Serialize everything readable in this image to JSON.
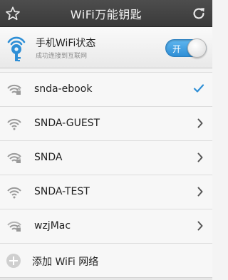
{
  "header": {
    "title": "WiFi万能钥匙",
    "left_icon": "star-outline-icon",
    "right_icon": "refresh-icon"
  },
  "status": {
    "title": "手机WiFi状态",
    "subtitle": "成功连接到互联网",
    "toggle_label": "开",
    "toggle_on": true,
    "accent_color": "#2f8fd6"
  },
  "networks": [
    {
      "ssid": "snda-ebook",
      "locked": true,
      "connected": true,
      "action_icon": "checkmark-icon"
    },
    {
      "ssid": "SNDA-GUEST",
      "locked": false,
      "connected": false,
      "action_icon": "chevron-right-icon"
    },
    {
      "ssid": "SNDA",
      "locked": true,
      "connected": false,
      "action_icon": "chevron-right-icon"
    },
    {
      "ssid": "SNDA-TEST",
      "locked": false,
      "connected": false,
      "action_icon": "chevron-right-icon"
    },
    {
      "ssid": "wzjMac",
      "locked": true,
      "connected": false,
      "action_icon": "chevron-right-icon"
    }
  ],
  "add_network": {
    "label": "添加 WiFi 网络",
    "icon": "plus-circle-icon"
  }
}
